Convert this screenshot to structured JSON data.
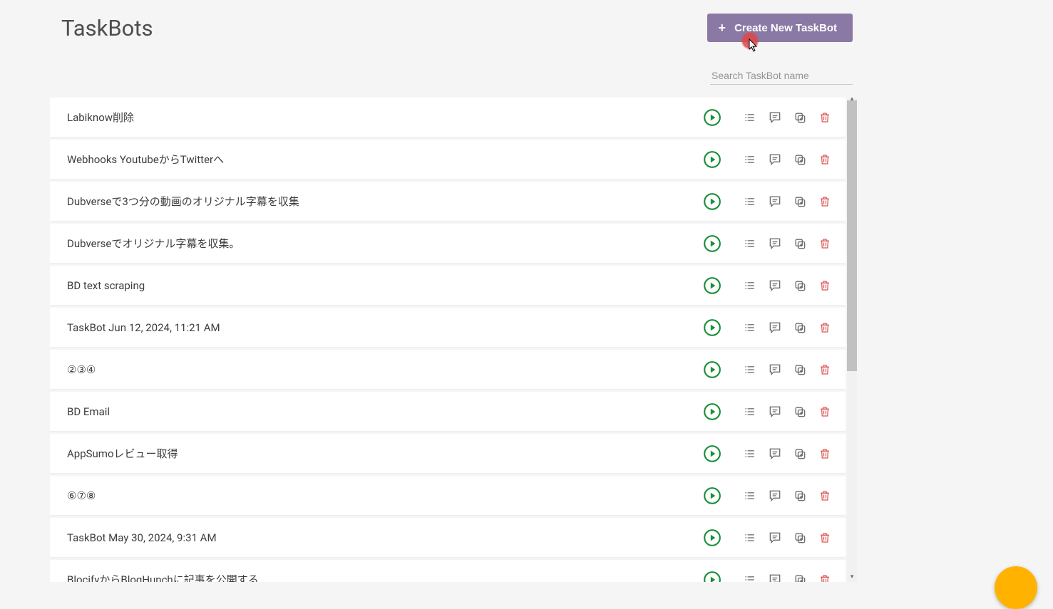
{
  "header": {
    "title": "TaskBots",
    "create_label": "Create New TaskBot"
  },
  "search": {
    "placeholder": "Search TaskBot name",
    "value": ""
  },
  "tasks": [
    {
      "name": "Labiknow削除"
    },
    {
      "name": "Webhooks YoutubeからTwitterへ"
    },
    {
      "name": "Dubverseで3つ分の動画のオリジナル字幕を収集"
    },
    {
      "name": "Dubverseでオリジナル字幕を収集。"
    },
    {
      "name": "BD text scraping"
    },
    {
      "name": "TaskBot Jun 12, 2024, 11:21 AM"
    },
    {
      "name": "②③④"
    },
    {
      "name": "BD Email"
    },
    {
      "name": "AppSumoレビュー取得"
    },
    {
      "name": "⑥⑦⑧"
    },
    {
      "name": "TaskBot May 30, 2024, 9:31 AM"
    },
    {
      "name": "BlocifyからBlogHunchに記事を公開する"
    }
  ],
  "icons": {
    "play": "play-icon",
    "list": "list-icon",
    "chat": "chat-icon",
    "duplicate": "duplicate-icon",
    "delete": "trash-icon",
    "plus": "plus-icon"
  },
  "colors": {
    "accent": "#8b79a5",
    "play": "#1b8f3a",
    "delete": "#d9534f",
    "icon_grey": "#6e6e6e",
    "fab": "#ffb300"
  }
}
